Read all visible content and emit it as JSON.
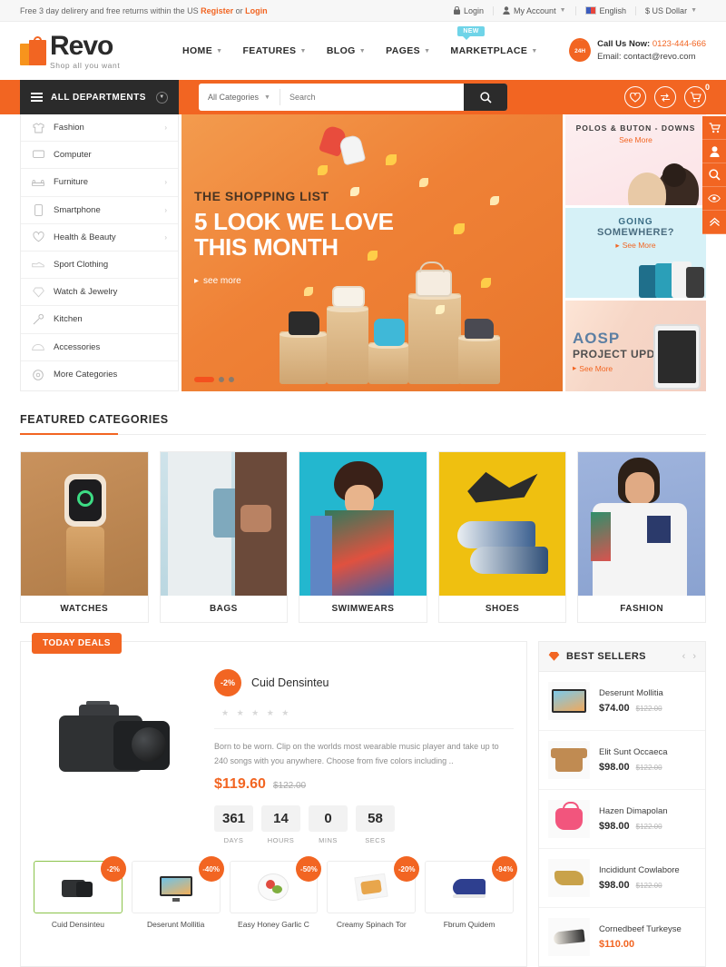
{
  "topbar": {
    "promo_text": "Free 3 day delirery and free returns within the US",
    "register": "Register",
    "or": "or",
    "login_link": "Login",
    "login": "Login",
    "my_account": "My Account",
    "language": "English",
    "currency": "$ US Dollar"
  },
  "header": {
    "logo_name": "Revo",
    "logo_tagline": "Shop all you want",
    "nav": [
      {
        "label": "HOME",
        "badge": null
      },
      {
        "label": "FEATURES",
        "badge": null
      },
      {
        "label": "BLOG",
        "badge": null
      },
      {
        "label": "PAGES",
        "badge": null
      },
      {
        "label": "MARKETPLACE",
        "badge": "New"
      }
    ],
    "call_label": "Call Us Now:",
    "call_number": "0123-444-666",
    "email_line": "Email: contact@revo.com",
    "headset_text": "24H"
  },
  "searchbar": {
    "all_departments": "ALL DEPARTMENTS",
    "categories_label": "All Categories",
    "search_placeholder": "Search",
    "cart_count": "0"
  },
  "categories": [
    {
      "label": "Fashion",
      "icon": "shirt-icon",
      "arrow": true
    },
    {
      "label": "Computer",
      "icon": "monitor-icon",
      "arrow": false
    },
    {
      "label": "Furniture",
      "icon": "sofa-icon",
      "arrow": true
    },
    {
      "label": "Smartphone",
      "icon": "phone-icon",
      "arrow": true
    },
    {
      "label": "Health & Beauty",
      "icon": "heart-icon",
      "arrow": true
    },
    {
      "label": "Sport Clothing",
      "icon": "shoe-icon",
      "arrow": false
    },
    {
      "label": "Watch & Jewelry",
      "icon": "diamond-icon",
      "arrow": false
    },
    {
      "label": "Kitchen",
      "icon": "spatula-icon",
      "arrow": false
    },
    {
      "label": "Accessories",
      "icon": "cap-icon",
      "arrow": false
    },
    {
      "label": "More Categories",
      "icon": "globe-icon",
      "arrow": false
    }
  ],
  "hero": {
    "kicker": "THE SHOPPING LIST",
    "title_line1": "5 LOOK WE LOVE",
    "title_line2": "THIS MONTH",
    "see_more": "see more",
    "slides": 3,
    "active_slide": 0
  },
  "promos": [
    {
      "title": "POLOS & BUTON - DOWNS",
      "subtitle": "",
      "cta": "See More"
    },
    {
      "title": "GOING",
      "subtitle": "SOMEWHERE?",
      "cta": "See More"
    },
    {
      "title": "AOSP",
      "subtitle": "PROJECT UPDATE",
      "cta": "See More"
    }
  ],
  "featured": {
    "section_title": "FEATURED CATEGORIES",
    "items": [
      {
        "name": "WATCHES"
      },
      {
        "name": "BAGS"
      },
      {
        "name": "SWIMWEARS"
      },
      {
        "name": "SHOES"
      },
      {
        "name": "FASHION"
      }
    ]
  },
  "deals": {
    "tag": "TODAY DEALS",
    "discount": "-2%",
    "product_name": "Cuid Densinteu",
    "stars": "★ ★ ★ ★ ★",
    "description": "Born to be worn. Clip on the worlds most wearable music player and take up to 240 songs with you anywhere. Choose from five colors including ..",
    "price_now": "$119.60",
    "price_old": "$122.00",
    "countdown": [
      {
        "value": "361",
        "label": "DAYS"
      },
      {
        "value": "14",
        "label": "HOURS"
      },
      {
        "value": "0",
        "label": "MINS"
      },
      {
        "value": "58",
        "label": "SECS"
      }
    ],
    "thumbs": [
      {
        "name": "Cuid Densinteu",
        "badge": "-2%",
        "selected": true
      },
      {
        "name": "Deserunt Mollitia",
        "badge": "-40%",
        "selected": false
      },
      {
        "name": "Easy Honey Garlic C",
        "badge": "-50%",
        "selected": false
      },
      {
        "name": "Creamy Spinach Tor",
        "badge": "-20%",
        "selected": false
      },
      {
        "name": "Fbrum Quidem",
        "badge": "-94%",
        "selected": false
      }
    ]
  },
  "bestsellers": {
    "title": "BEST SELLERS",
    "items": [
      {
        "name": "Deserunt Mollitia",
        "price": "$74.00",
        "old": "$122.00",
        "sale": false
      },
      {
        "name": "Elit Sunt Occaeca",
        "price": "$98.00",
        "old": "$122.00",
        "sale": false
      },
      {
        "name": "Hazen Dimapolan",
        "price": "$98.00",
        "old": "$122.00",
        "sale": false
      },
      {
        "name": "Incididunt Cowlabore",
        "price": "$98.00",
        "old": "$122.00",
        "sale": false
      },
      {
        "name": "Cornedbeef Turkeyse",
        "price": "$110.00",
        "old": "",
        "sale": true
      }
    ]
  },
  "floatbar": [
    {
      "icon": "cart-icon"
    },
    {
      "icon": "user-icon"
    },
    {
      "icon": "search-icon"
    },
    {
      "icon": "eye-icon"
    },
    {
      "icon": "chevron-up-icon"
    }
  ],
  "colors": {
    "brand_orange": "#f26522",
    "dark": "#2b2b2b",
    "badge_cyan": "#6fd4e8"
  }
}
